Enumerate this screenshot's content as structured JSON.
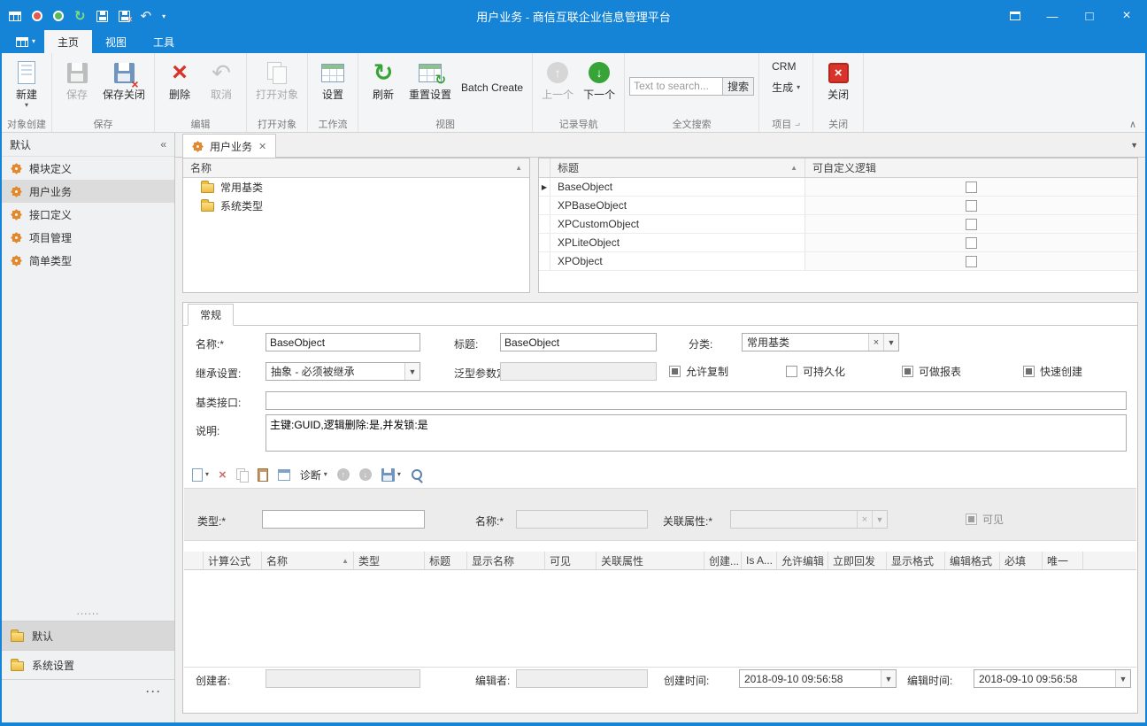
{
  "window": {
    "title": "用户业务 - 商信互联企业信息管理平台"
  },
  "colors": {
    "titlebar_blue": "#1583d6",
    "delete_red": "#d9342b",
    "refresh_green": "#36a437",
    "gear_orange": "#e2882e",
    "folder_yellow": "#eebc3f"
  },
  "ribbon": {
    "tabs": [
      {
        "label": "主页"
      },
      {
        "label": "视图"
      },
      {
        "label": "工具"
      }
    ],
    "groups": [
      {
        "label": "对象创建",
        "buttons": [
          {
            "label": "新建"
          }
        ]
      },
      {
        "label": "保存",
        "buttons": [
          {
            "label": "保存"
          },
          {
            "label": "保存关闭"
          }
        ]
      },
      {
        "label": "编辑",
        "buttons": [
          {
            "label": "删除"
          },
          {
            "label": "取消"
          }
        ]
      },
      {
        "label": "打开对象",
        "buttons": [
          {
            "label": "打开对象"
          }
        ]
      },
      {
        "label": "工作流",
        "buttons": [
          {
            "label": "设置"
          }
        ]
      },
      {
        "label": "视图",
        "buttons": [
          {
            "label": "刷新"
          },
          {
            "label": "重置设置"
          },
          {
            "label": "Batch Create"
          }
        ]
      },
      {
        "label": "记录导航",
        "buttons": [
          {
            "label": "上一个"
          },
          {
            "label": "下一个"
          }
        ]
      },
      {
        "label": "全文搜索",
        "search": {
          "placeholder": "Text to search...",
          "button": "搜索"
        }
      },
      {
        "label": "项目",
        "buttons": [
          {
            "label": "CRM"
          },
          {
            "label": "生成"
          }
        ]
      },
      {
        "label": "关闭",
        "buttons": [
          {
            "label": "关闭"
          }
        ]
      }
    ]
  },
  "sidebar": {
    "header": "默认",
    "collapse": "«",
    "items": [
      {
        "label": "模块定义"
      },
      {
        "label": "用户业务"
      },
      {
        "label": "接口定义"
      },
      {
        "label": "项目管理"
      },
      {
        "label": "简单类型"
      }
    ],
    "separator": "......",
    "groups": [
      {
        "label": "默认"
      },
      {
        "label": "系统设置"
      }
    ],
    "overflow": "···"
  },
  "document": {
    "tab": "用户业务",
    "tree": {
      "header": "名称",
      "items": [
        {
          "label": "常用基类"
        },
        {
          "label": "系统类型"
        }
      ]
    },
    "grid": {
      "columns": [
        {
          "label": "标题"
        },
        {
          "label": "可自定义逻辑"
        }
      ],
      "rows": [
        {
          "title": "BaseObject"
        },
        {
          "title": "XPBaseObject"
        },
        {
          "title": "XPCustomObject"
        },
        {
          "title": "XPLiteObject"
        },
        {
          "title": "XPObject"
        }
      ]
    }
  },
  "detail": {
    "tab": "常规",
    "form": {
      "name_label": "名称:*",
      "name_value": "BaseObject",
      "title_label": "标题:",
      "title_value": "BaseObject",
      "category_label": "分类:",
      "category_value": "常用基类",
      "inherit_label": "继承设置:",
      "inherit_value": "抽象 - 必须被继承",
      "generic_label": "泛型参数定义:",
      "allow_copy_label": "允许复制",
      "persist_label": "可持久化",
      "report_label": "可做报表",
      "quick_create_label": "快速创建",
      "interface_label": "基类接口:",
      "desc_label": "说明:",
      "desc_value": "主键:GUID,逻辑删除:是,并发锁:是"
    },
    "toolbar": {
      "diagnose_label": "诊断"
    },
    "subform": {
      "type_label": "类型:*",
      "name_label": "名称:*",
      "assoc_label": "关联属性:*",
      "visible_label": "可见"
    },
    "grid_columns": [
      "计算公式",
      "名称",
      "类型",
      "标题",
      "显示名称",
      "可见",
      "关联属性",
      "创建...",
      "Is A...",
      "允许编辑",
      "立即回发",
      "显示格式",
      "编辑格式",
      "必填",
      "唯一"
    ],
    "footer": {
      "creator_label": "创建者:",
      "editor_label": "编辑者:",
      "created_label": "创建时间:",
      "created_value": "2018-09-10 09:56:58",
      "edited_label": "编辑时间:",
      "edited_value": "2018-09-10 09:56:58"
    }
  }
}
